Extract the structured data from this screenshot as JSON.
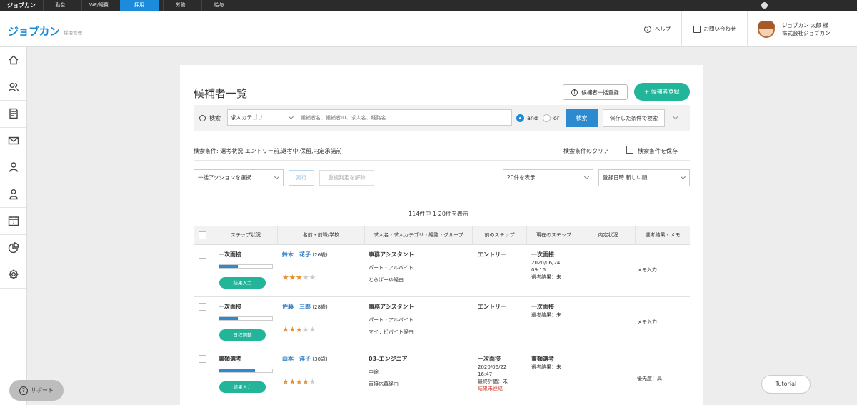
{
  "topnav": {
    "brand": "ジョブカン",
    "tabs": [
      "勤怠",
      "WF/経費",
      "採用",
      "労務",
      "給与"
    ],
    "active": "採用"
  },
  "header": {
    "logo": "ジョブカン",
    "logo_sub": "採用管理",
    "help": "ヘルプ",
    "contact": "お問い合わせ",
    "user_name": "ジョブカン 太郎 様",
    "company": "株式会社ジョブカン"
  },
  "sidebar": [
    "home-icon",
    "candidates-icon",
    "document-icon",
    "mail-icon",
    "person-icon",
    "user-group-icon",
    "calendar-icon",
    "chart-icon",
    "gear-icon"
  ],
  "page": {
    "title": "候補者一覧",
    "bulk_button": "候補者一括登録",
    "register_button": "+ 候補者登録"
  },
  "search": {
    "label": "検索",
    "category": "求人カテゴリ",
    "placeholder": "候補者名、候補者ID、求人名、経路名",
    "and": "and",
    "or": "or",
    "search_button": "検索",
    "saved_button": "保存した条件で検索"
  },
  "conditions": {
    "text": "検索条件: 選考状況:エントリー前,選考中,保留,内定承諾前",
    "clear": "検索条件のクリア",
    "save": "検索条件を保存"
  },
  "actions": {
    "bulk_select": "一括アクションを選択",
    "execute": "実行",
    "dup_release": "重複判定を解除",
    "per_page": "20件を表示",
    "sort": "登録日時 新しい順"
  },
  "count": "114件中 1-20件を表示",
  "table": {
    "headers": [
      "ステップ状況",
      "名前・前職/学校",
      "求人名・求人カテゴリ・経路・グループ",
      "前のステップ",
      "現在のステップ",
      "内定状況",
      "選考結果・メモ"
    ],
    "rows": [
      {
        "step": "一次面接",
        "progress": 0.35,
        "action": "結果入力",
        "name": "鈴木　花子",
        "age": "(26歳)",
        "stars": 3,
        "job": "事務アシスタント",
        "category": "パート・アルバイト",
        "route": "とらばーゆ経由",
        "prev": "エントリー",
        "cur": "一次面接",
        "cur_l1": "2020/06/24",
        "cur_l2": "09:15",
        "cur_l3": "選考結果：未",
        "memo": "メモ入力"
      },
      {
        "step": "一次面接",
        "progress": 0.35,
        "action": "日程調整",
        "name": "佐藤　三郎",
        "age": "(28歳)",
        "stars": 3,
        "job": "事務アシスタント",
        "category": "パート・アルバイト",
        "route": "マイナビバイト経由",
        "prev": "エントリー",
        "cur": "一次面接",
        "cur_l1": "選考結果：未",
        "cur_l2": "",
        "cur_l3": "",
        "memo": "メモ入力"
      },
      {
        "step": "書類選考",
        "progress": 0.68,
        "action": "結果入力",
        "name": "山本　洋子",
        "age": "(30歳)",
        "stars": 4,
        "job": "03-エンジニア",
        "category": "中途",
        "route": "直接応募経由",
        "prev": "一次面接",
        "prev_l1": "2020/06/22",
        "prev_l2": "16:47",
        "prev_l3": "最終評価：未",
        "prev_l4": "結果未連絡",
        "cur": "書類選考",
        "cur_l1": "選考結果：未",
        "cur_l2": "",
        "cur_l3": "",
        "memo": "優先度：高"
      }
    ]
  },
  "support": "サポート",
  "tutorial": "Tutorial"
}
